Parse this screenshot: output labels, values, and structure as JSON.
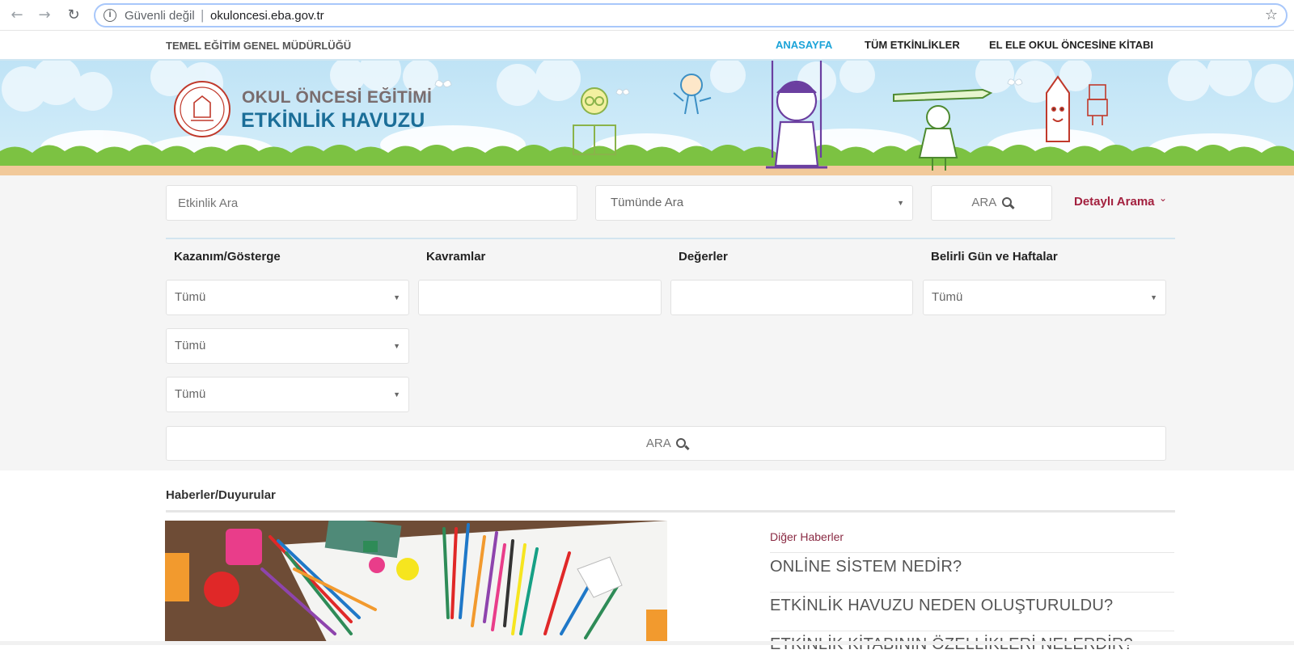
{
  "browser": {
    "insecure_label": "Güvenli değil",
    "separator": "|",
    "url": "okuloncesi.eba.gov.tr"
  },
  "topnav": {
    "org": "TEMEL EĞİTİM GENEL MÜDÜRLÜĞÜ",
    "items": [
      "ANASAYFA",
      "TÜM ETKİNLİKLER",
      "EL ELE OKUL ÖNCESİNE KİTABI"
    ],
    "active_color": "#1ba3d8"
  },
  "banner": {
    "title_line1": "OKUL ÖNCESİ EĞİTİMİ",
    "title_line2": "ETKİNLİK HAVUZU",
    "logo_icon": "meb-seal-icon"
  },
  "search": {
    "placeholder": "Etkinlik Ara",
    "scope_selected": "Tümünde Ara",
    "button_label": "ARA",
    "detailed_label": "Detaylı Arama"
  },
  "filters": {
    "headers": [
      "Kazanım/Gösterge",
      "Kavramlar",
      "Değerler",
      "Belirli Gün ve Haftalar"
    ],
    "kazanim_selects": [
      "Tümü",
      "Tümü",
      "Tümü"
    ],
    "belirli_gun_select": "Tümü",
    "submit_label": "ARA"
  },
  "news": {
    "heading": "Haberler/Duyurular",
    "other_label": "Diğer Haberler",
    "links": [
      "ONLİNE SİSTEM NEDİR?",
      "ETKİNLİK HAVUZU NEDEN OLUŞTURULDU?",
      "ETKİNLİK KİTABININ ÖZELLİKLERİ NELERDİR?"
    ]
  },
  "colors": {
    "brand_blue": "#1b6e98",
    "accent_red": "#a3213f",
    "grass": "#7cc242"
  }
}
